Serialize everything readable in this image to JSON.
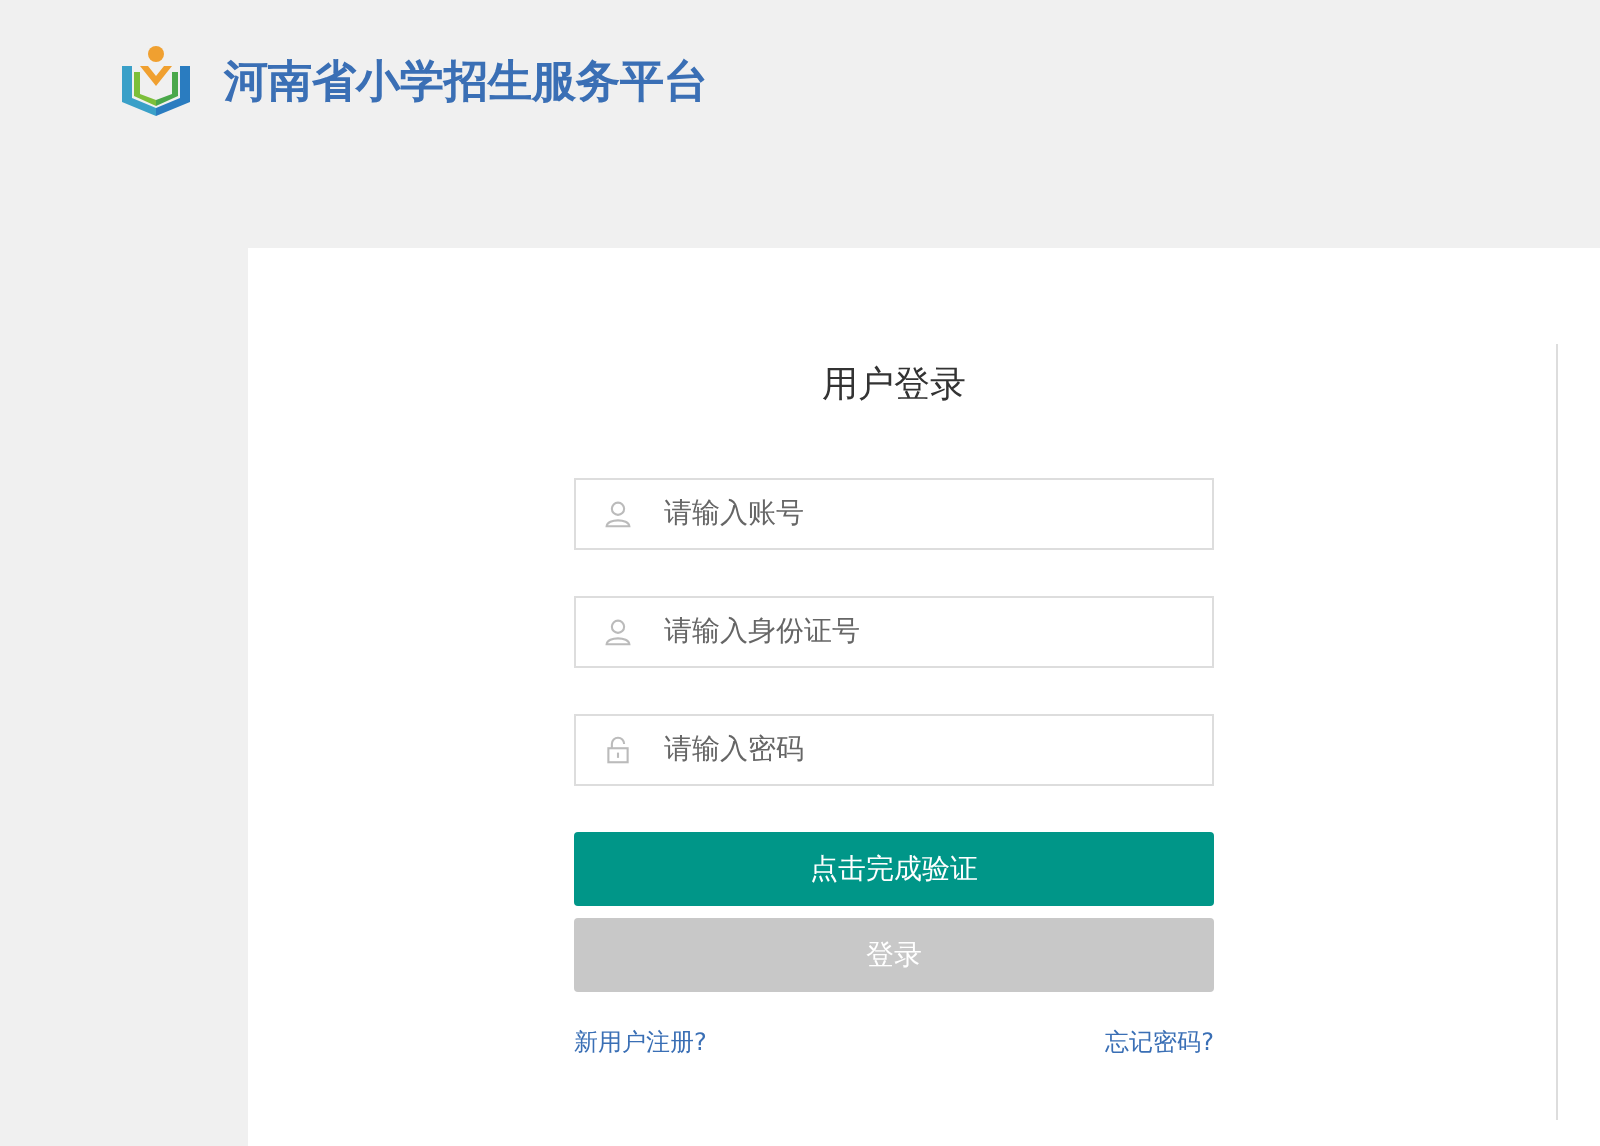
{
  "header": {
    "title": "河南省小学招生服务平台"
  },
  "login": {
    "title": "用户登录",
    "fields": [
      {
        "kind": "user",
        "placeholder": "请输入账号"
      },
      {
        "kind": "user",
        "placeholder": "请输入身份证号"
      },
      {
        "kind": "lock",
        "placeholder": "请输入密码"
      }
    ],
    "verify_button": "点击完成验证",
    "login_button": {
      "label": "登录",
      "disabled": true
    },
    "links": [
      "新用户注册?",
      "忘记密码?"
    ]
  }
}
